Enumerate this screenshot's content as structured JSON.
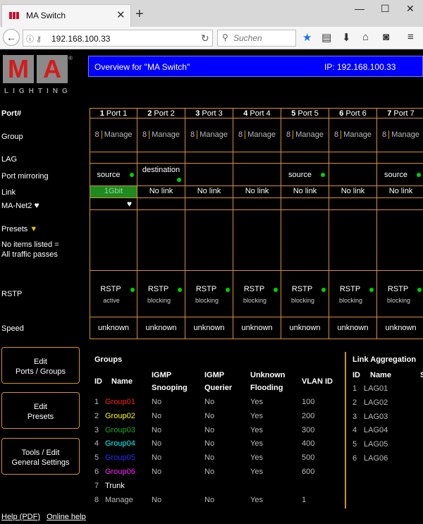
{
  "browser": {
    "tab_title": "MA Switch",
    "url": "192.168.100.33",
    "search_placeholder": "Suchen"
  },
  "header": {
    "logo_text": [
      "M",
      "A"
    ],
    "logo_sub": "LIGHTING",
    "logo_reg": "®",
    "title": "Overview for \"MA Switch\"",
    "ip": "IP: 192.168.100.33"
  },
  "rows": {
    "port": "Port#",
    "group": "Group",
    "lag": "LAG",
    "mirroring": "Port mirroring",
    "link": "Link",
    "manet": "MA-Net2",
    "presets": "Presets",
    "presets_note1": "No items listed =",
    "presets_note2": "All traffic passes",
    "rstp": "RSTP",
    "speed": "Speed"
  },
  "ports": [
    {
      "num": "1",
      "label": "Port 1",
      "group_num": "8",
      "group_name": "Manage",
      "mirror": "source",
      "link": "1Gbit",
      "link_up": true,
      "manet_heart": true,
      "rstp": "RSTP",
      "rstp_state": "active",
      "speed": "unknown"
    },
    {
      "num": "2",
      "label": "Port 2",
      "group_num": "8",
      "group_name": "Manage",
      "mirror": "destination",
      "link": "No link",
      "link_up": false,
      "manet_heart": false,
      "rstp": "RSTP",
      "rstp_state": "blocking",
      "speed": "unknown"
    },
    {
      "num": "3",
      "label": "Port 3",
      "group_num": "8",
      "group_name": "Manage",
      "mirror": "",
      "link": "No link",
      "link_up": false,
      "manet_heart": false,
      "rstp": "RSTP",
      "rstp_state": "blocking",
      "speed": "unknown"
    },
    {
      "num": "4",
      "label": "Port 4",
      "group_num": "8",
      "group_name": "Manage",
      "mirror": "",
      "link": "No link",
      "link_up": false,
      "manet_heart": false,
      "rstp": "RSTP",
      "rstp_state": "blocking",
      "speed": "unknown"
    },
    {
      "num": "5",
      "label": "Port 5",
      "group_num": "8",
      "group_name": "Manage",
      "mirror": "source",
      "link": "No link",
      "link_up": false,
      "manet_heart": false,
      "rstp": "RSTP",
      "rstp_state": "blocking",
      "speed": "unknown"
    },
    {
      "num": "6",
      "label": "Port 6",
      "group_num": "8",
      "group_name": "Manage",
      "mirror": "",
      "link": "No link",
      "link_up": false,
      "manet_heart": false,
      "rstp": "RSTP",
      "rstp_state": "blocking",
      "speed": "unknown"
    },
    {
      "num": "7",
      "label": "Port 7",
      "group_num": "8",
      "group_name": "Manage",
      "mirror": "source",
      "link": "No link",
      "link_up": false,
      "manet_heart": false,
      "rstp": "RSTP",
      "rstp_state": "blocking",
      "speed": "unknown"
    }
  ],
  "buttons": {
    "edit_ports": [
      "Edit",
      "Ports / Groups"
    ],
    "edit_presets": [
      "Edit",
      "Presets"
    ],
    "tools": [
      "Tools / Edit",
      "General Settings"
    ]
  },
  "groups": {
    "title": "Groups",
    "headers": {
      "id": "ID",
      "name": "Name",
      "igmp_snooping": [
        "IGMP",
        "Snooping"
      ],
      "igmp_querier": [
        "IGMP",
        "Querier"
      ],
      "unknown_flooding": [
        "Unknown",
        "Flooding"
      ],
      "vlan": "VLAN ID"
    },
    "rows": [
      {
        "id": "1",
        "name": "Group01",
        "color": "#ff2020",
        "snoop": "No",
        "querier": "No",
        "flood": "Yes",
        "vlan": "100"
      },
      {
        "id": "2",
        "name": "Group02",
        "color": "#ffff00",
        "snoop": "No",
        "querier": "No",
        "flood": "Yes",
        "vlan": "200"
      },
      {
        "id": "3",
        "name": "Group03",
        "color": "#22aa22",
        "snoop": "No",
        "querier": "No",
        "flood": "Yes",
        "vlan": "300"
      },
      {
        "id": "4",
        "name": "Group04",
        "color": "#00ffff",
        "snoop": "No",
        "querier": "No",
        "flood": "Yes",
        "vlan": "400"
      },
      {
        "id": "5",
        "name": "Group05",
        "color": "#2a2aff",
        "snoop": "No",
        "querier": "No",
        "flood": "Yes",
        "vlan": "500"
      },
      {
        "id": "6",
        "name": "Group06",
        "color": "#ff20ff",
        "snoop": "No",
        "querier": "No",
        "flood": "Yes",
        "vlan": "600"
      },
      {
        "id": "7",
        "name": "Trunk",
        "color": "#ffffff",
        "snoop": "",
        "querier": "",
        "flood": "",
        "vlan": ""
      },
      {
        "id": "8",
        "name": "Manage",
        "color": "#bbbbbb",
        "snoop": "No",
        "querier": "No",
        "flood": "Yes",
        "vlan": "1"
      }
    ]
  },
  "lag": {
    "title": "Link Aggregation",
    "headers": {
      "id": "ID",
      "name": "Name",
      "extra": "S"
    },
    "rows": [
      {
        "id": "1",
        "name": "LAG01"
      },
      {
        "id": "2",
        "name": "LAG02"
      },
      {
        "id": "3",
        "name": "LAG03"
      },
      {
        "id": "4",
        "name": "LAG04"
      },
      {
        "id": "5",
        "name": "LAG05"
      },
      {
        "id": "6",
        "name": "LAG06"
      }
    ]
  },
  "footer": {
    "help": "Help (PDF)",
    "online_help": "Online help"
  }
}
